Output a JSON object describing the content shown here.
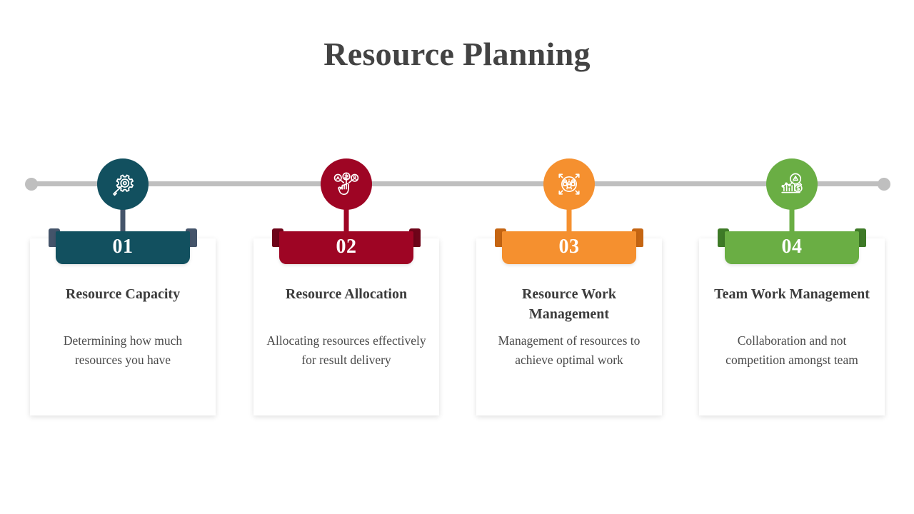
{
  "slide": {
    "title": "Resource Planning",
    "background_color": "#ffffff",
    "title_color": "#434343"
  },
  "timeline": {
    "rail_color": "#bfbfbf",
    "end_dot_left": "timeline-end-dot-left",
    "end_dot_right": "timeline-end-dot-right"
  },
  "steps": [
    {
      "number": "01",
      "heading": "Resource Capacity",
      "description": "Determining how much resources you have",
      "color": "#12505F",
      "tab_color": "#44546A",
      "stem_color": "#44546A",
      "icon": "gear-magnifier-icon"
    },
    {
      "number": "02",
      "heading": "Resource Allocation",
      "description": "Allocating resources effectively for result delivery",
      "color": "#9E0524",
      "tab_color": "#6E0419",
      "stem_color": "#9E0524",
      "icon": "hand-resource-nodes-icon"
    },
    {
      "number": "03",
      "heading": "Resource Work Management",
      "description": "Management of resources to achieve optimal work",
      "color": "#F5902F",
      "tab_color": "#C56512",
      "stem_color": "#F5902F",
      "icon": "people-expand-arrows-icon"
    },
    {
      "number": "04",
      "heading": "Team Work Management",
      "description": "Collaboration and not competition amongst team",
      "color": "#6AAE44",
      "tab_color": "#3E7A27",
      "stem_color": "#6AAE44",
      "icon": "bar-chart-alert-dollar-icon"
    }
  ]
}
